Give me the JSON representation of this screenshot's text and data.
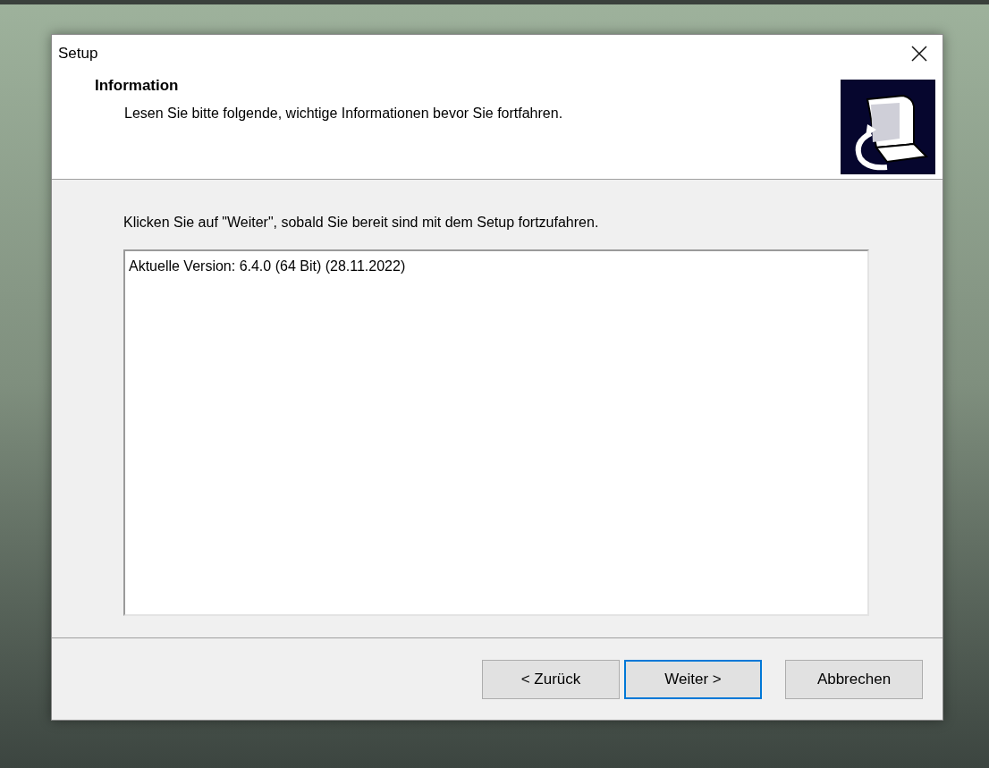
{
  "window": {
    "title": "Setup"
  },
  "header": {
    "title": "Information",
    "subtitle": "Lesen Sie bitte folgende, wichtige Informationen bevor Sie fortfahren."
  },
  "instruction": "Klicken Sie auf \"Weiter\", sobald Sie bereit sind mit dem Setup fortzufahren.",
  "info_text": "Aktuelle Version: 6.4.0 (64 Bit) (28.11.2022)",
  "buttons": [
    {
      "label": "< Zurück",
      "focused": false
    },
    {
      "label": "Weiter >",
      "focused": true
    },
    {
      "label": "Abbrechen",
      "focused": false
    }
  ]
}
